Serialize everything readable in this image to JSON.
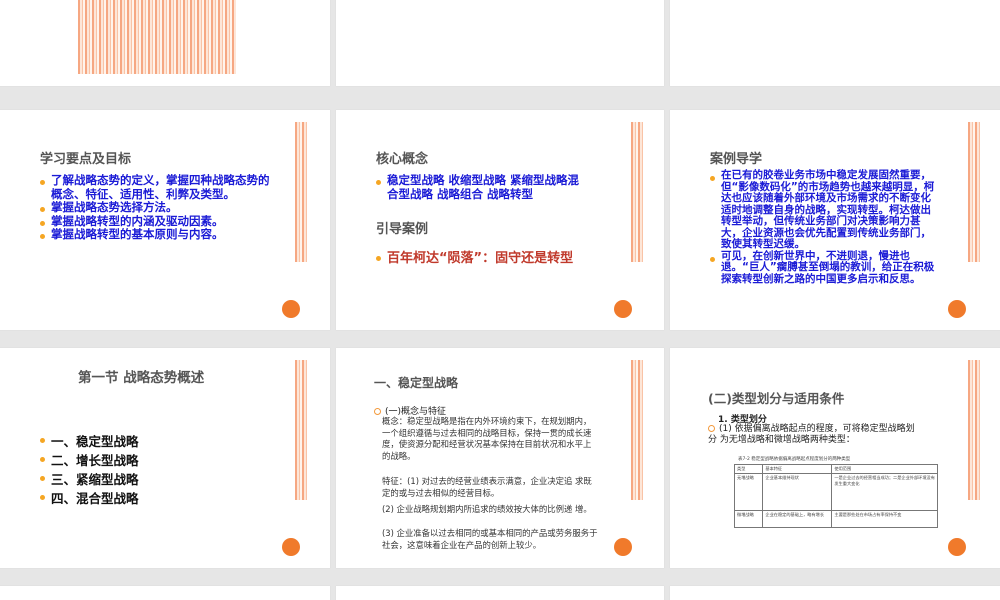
{
  "slides": {
    "s1": {
      "title": "学习要点及目标",
      "items": [
        "了解战略态势的定义，掌握四种战略态势的概念、特征、适用性、利弊及类型。",
        "掌握战略态势选择方法。",
        "掌握战略转型的内涵及驱动因素。",
        "掌握战略转型的基本原则与内容。"
      ]
    },
    "s2": {
      "title": "核心概念",
      "concepts": "稳定型战略 收缩型战略 紧缩型战略混合型战略 战略组合 战略转型",
      "case_title": "引导案例",
      "case": "百年柯达“陨落”：固守还是转型"
    },
    "s3": {
      "title": "案例导学",
      "items": [
        "在已有的胶卷业务市场中稳定发展固然重要，但“影像数码化”的市场趋势也越来越明显，柯达也应该随着外部环境及市场需求的不断变化适时地调整自身的战略，实现转型。柯达做出转型举动，但传统业务部门对决策影响力甚大，企业资源也会优先配置到传统业务部门，致使其转型迟缓。",
        "可见，在创新世界中，不进则退，慢进也退。“巨人”瘸膊甚至倒塌的教训，给正在积极探索转型创新之路的中国更多启示和反思。"
      ]
    },
    "s4": {
      "title": "第一节 战略态势概述",
      "items": [
        "一、稳定型战略",
        "二、增长型战略",
        "三、紧缩型战略",
        "四、混合型战略"
      ]
    },
    "s5": {
      "title": "一、稳定型战略",
      "sub": "(一)概念与特征",
      "paras": [
        "概念：稳定型战略是指在内外环境约束下，在规划期内，一个组织遵循与过去相同的战略目标，保持一贯的成长速度，使资源分配和经营状况基本保持在目前状况和水平上的战略。",
        "特征：(1) 对过去的经营业绩表示满意，企业决定追 求既定的或与过去相似的经营目标。",
        "(2) 企业战略规划期内所追求的绩效按大体的比例递 增。",
        "(3) 企业准备以过去相同的或基本相同的产品或劳务服务于社会，这意味着企业在产品的创新上较少。"
      ]
    },
    "s6": {
      "title": "(二)类型划分与适用条件",
      "sub": "1. 类型划分",
      "body": "(1) 依据偏离战略起点的程度，可将稳定型战略划分 为无增战略和微增战略两种类型：",
      "table_caption": "表7-2 稳定型战略依据偏离战略起点程度划分的两种类型",
      "table": [
        [
          "类型",
          "基本特征",
          "使用范围"
        ],
        [
          "无增战略",
          "企业基本维持现状",
          "一是企业过去的经营相当成功；二是企业外部环境没有发生重大变化"
        ],
        [
          "微增战略",
          "企业在稳定的基础上，略有增长",
          "主要是那些处在市场占有率保持不变"
        ]
      ]
    }
  },
  "colors": {
    "accent": "#f07a2b",
    "blue_text": "#1b1bd6",
    "red_text": "#c0392b"
  }
}
